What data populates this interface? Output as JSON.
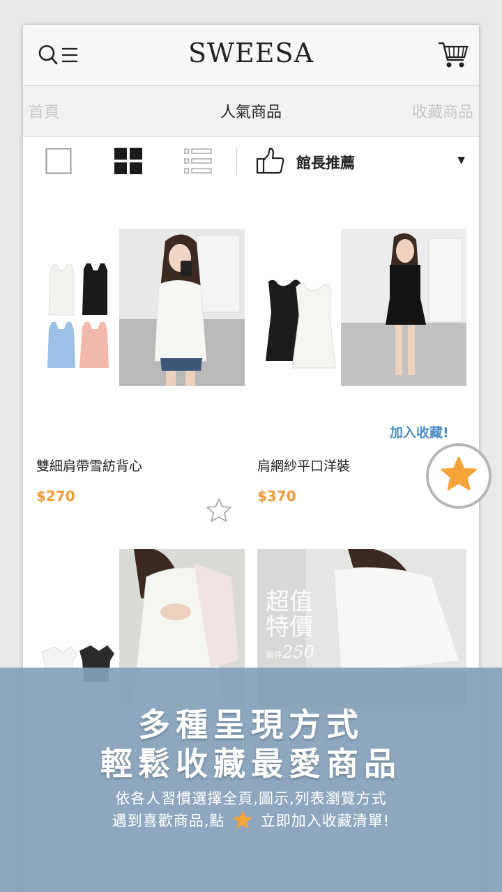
{
  "header": {
    "brand": "SWEESA",
    "menu_icon": "search-menu-icon",
    "cart_icon": "cart-icon"
  },
  "tabs": {
    "left": "首頁",
    "active": "人氣商品",
    "right": "收藏商品"
  },
  "toolbar": {
    "views": [
      "single-view-icon",
      "grid-view-icon",
      "list-view-icon"
    ],
    "selected_view": "grid",
    "sort_label": "館長推薦"
  },
  "products": [
    {
      "name": "雙細肩帶雪紡背心",
      "price": "$270",
      "favorited": false
    },
    {
      "name": "肩網紗平口洋裝",
      "price": "$370",
      "favorited": true
    },
    {
      "name": "",
      "price": ""
    },
    {
      "name": "",
      "price": ""
    }
  ],
  "product_overlays": {
    "badge_line1": "超值",
    "badge_line2": "特價",
    "badge_price": "250",
    "badge_small": "兩件"
  },
  "tooltip": {
    "add_favorite": "加入收藏!"
  },
  "promo": {
    "headline1": "多種呈現方式",
    "headline2": "輕鬆收藏最愛商品",
    "sub1": "依各人習慣選擇全頁,圖示,列表瀏覽方式",
    "sub2_before": "遇到喜歡商品,點",
    "sub2_after": "立即加入收藏清單!"
  },
  "colors": {
    "accent_price": "#f19a38",
    "tooltip_blue": "#4f8fc4",
    "banner": "#84a0ba",
    "star_fill": "#f5a43a"
  }
}
